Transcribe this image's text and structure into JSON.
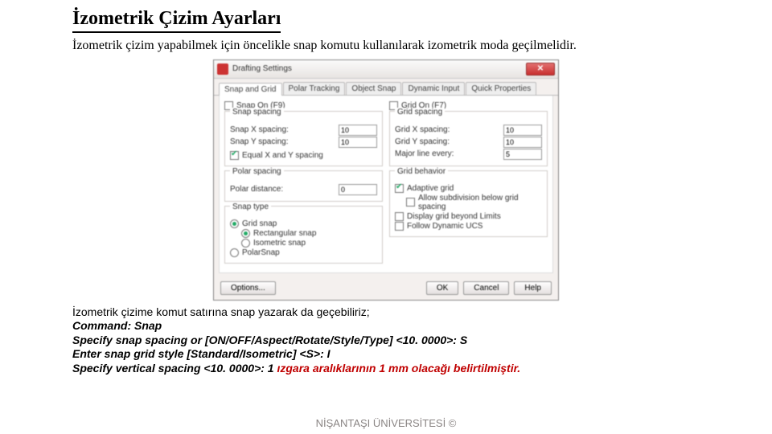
{
  "title": "İzometrik Çizim Ayarları",
  "intro": "İzometrik çizim yapabilmek için öncelikle snap komutu kullanılarak izometrik moda geçilmelidir.",
  "dialog": {
    "window_title": "Drafting Settings",
    "close_glyph": "✕",
    "tabs": [
      "Snap and Grid",
      "Polar Tracking",
      "Object Snap",
      "Dynamic Input",
      "Quick Properties"
    ],
    "left": {
      "snap_on": "Snap On (F9)",
      "snap_on_checked": false,
      "group_spacing": "Snap spacing",
      "x_label": "Snap X spacing:",
      "x_value": "10",
      "y_label": "Snap Y spacing:",
      "y_value": "10",
      "equal_label": "Equal X and Y spacing",
      "equal_checked": true,
      "group_polar": "Polar spacing",
      "polar_label": "Polar distance:",
      "polar_value": "0",
      "group_type": "Snap type",
      "type_grid": "Grid snap",
      "type_grid_on": true,
      "type_rect": "Rectangular snap",
      "type_rect_on": true,
      "type_iso": "Isometric snap",
      "type_iso_on": false,
      "type_polar": "PolarSnap",
      "type_polar_on": false
    },
    "right": {
      "grid_on": "Grid On (F7)",
      "grid_on_checked": false,
      "group_spacing": "Grid spacing",
      "x_label": "Grid X spacing:",
      "x_value": "10",
      "y_label": "Grid Y spacing:",
      "y_value": "10",
      "major_label": "Major line every:",
      "major_value": "5",
      "group_behavior": "Grid behavior",
      "adaptive": "Adaptive grid",
      "adaptive_on": true,
      "allow_sub": "Allow subdivision below grid spacing",
      "allow_sub_on": false,
      "beyond": "Display grid beyond Limits",
      "beyond_on": false,
      "follow": "Follow Dynamic UCS",
      "follow_on": false
    },
    "buttons": {
      "options": "Options...",
      "ok": "OK",
      "cancel": "Cancel",
      "help": "Help"
    }
  },
  "below": {
    "l1": "İzometrik çizime komut satırına snap yazarak da geçebiliriz;",
    "l2": "Command: Snap",
    "l3": "Specify snap spacing or [ON/OFF/Aspect/Rotate/Style/Type] <10. 0000>: S",
    "l4": "Enter snap grid style [Standard/Isometric] <S>: I",
    "l5a": "Specify vertical spacing <10. 0000>: 1 ",
    "l5b": "ızgara aralıklarının 1 mm olacağı belirtilmiştir."
  },
  "footer": "NİŞANTAŞI ÜNİVERSİTESİ ©"
}
